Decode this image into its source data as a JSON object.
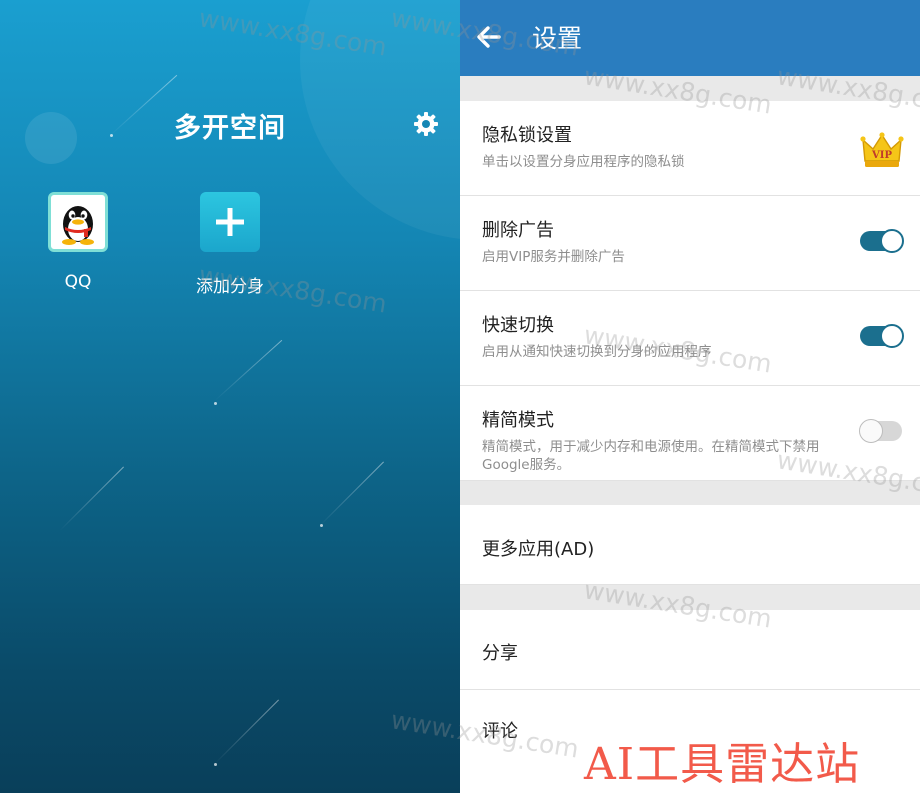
{
  "left": {
    "title": "多开空间",
    "apps": [
      {
        "label": "QQ",
        "icon": "qq-penguin-icon"
      },
      {
        "label": "添加分身",
        "icon": "plus-icon"
      }
    ]
  },
  "settings": {
    "title": "设置",
    "items": [
      {
        "title": "隐私锁设置",
        "subtitle": "单击以设置分身应用程序的隐私锁",
        "badge": "VIP"
      },
      {
        "title": "删除广告",
        "subtitle": "启用VIP服务并删除广告",
        "toggle": "on"
      },
      {
        "title": "快速切换",
        "subtitle": "启用从通知快速切换到分身的应用程序",
        "toggle": "on"
      },
      {
        "title": "精简模式",
        "subtitle": "精简模式，用于减少内存和电源使用。在精简模式下禁用Google服务。",
        "toggle": "off"
      },
      {
        "title": "更多应用(AD)"
      },
      {
        "title": "分享"
      },
      {
        "title": "评论"
      }
    ]
  },
  "watermark": "www.xx8g.com",
  "brand": "AI工具雷达站",
  "colors": {
    "accent": "#2a7dbf",
    "toggle_on": "#1b6f8e",
    "brand": "#f25a4a"
  }
}
